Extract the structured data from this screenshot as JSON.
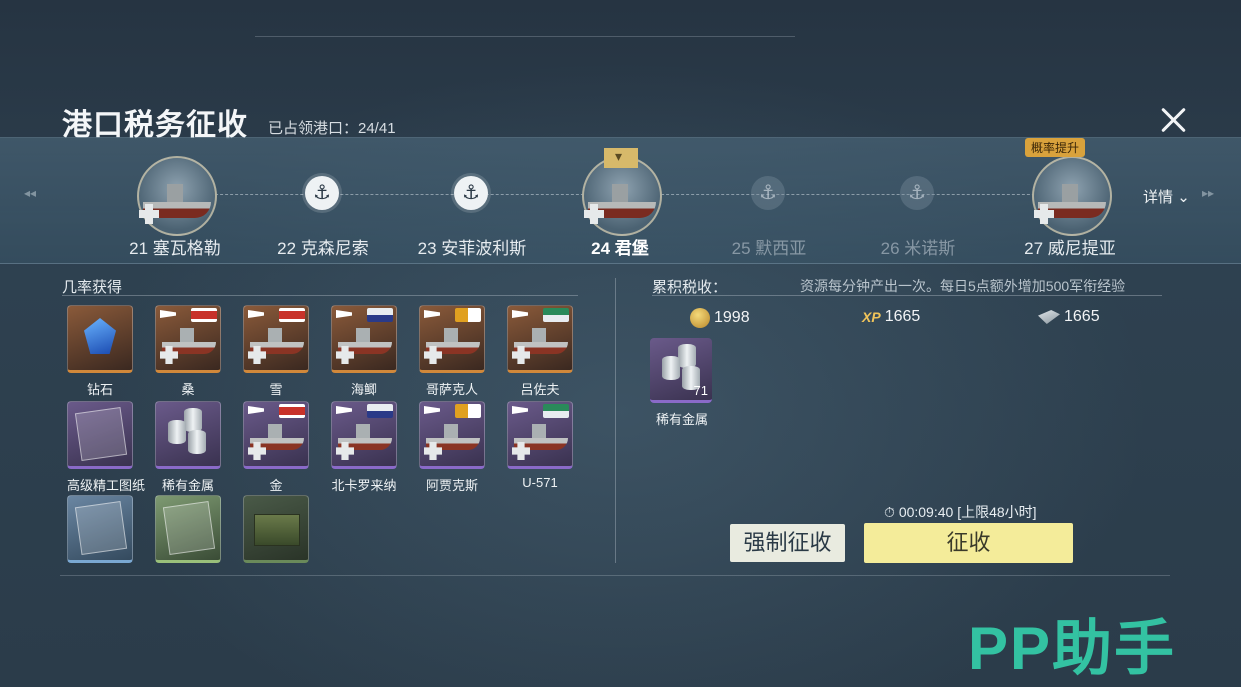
{
  "header": {
    "title": "港口税务征收",
    "occupied": "已占领港口：24/41"
  },
  "route": {
    "details_label": "详情",
    "probability_badge": "概率提升",
    "nodes": [
      {
        "label": "21 塞瓦格勒",
        "state": "ship"
      },
      {
        "label": "22 克森尼索",
        "state": "anchor"
      },
      {
        "label": "23 安菲波利斯",
        "state": "anchor"
      },
      {
        "label": "24 君堡",
        "state": "current"
      },
      {
        "label": "25 默西亚",
        "state": "locked"
      },
      {
        "label": "26 米诺斯",
        "state": "locked"
      },
      {
        "label": "27 威尼提亚",
        "state": "ship"
      }
    ]
  },
  "drops": {
    "title": "几率获得",
    "items": [
      {
        "name": "钻石",
        "rarity": "orange",
        "kind": "diamond"
      },
      {
        "name": "桑",
        "rarity": "orange",
        "kind": "ship",
        "flag": "red"
      },
      {
        "name": "雪",
        "rarity": "orange",
        "kind": "ship",
        "flag": "red"
      },
      {
        "name": "海鲫",
        "rarity": "orange",
        "kind": "ship",
        "flag": "us"
      },
      {
        "name": "哥萨克人",
        "rarity": "orange",
        "kind": "ship",
        "flag": "it"
      },
      {
        "name": "吕佐夫",
        "rarity": "orange",
        "kind": "ship",
        "flag": "de"
      },
      {
        "name": "高级精工图纸",
        "rarity": "purple",
        "kind": "blueprint"
      },
      {
        "name": "稀有金属",
        "rarity": "purple",
        "kind": "metal"
      },
      {
        "name": "金",
        "rarity": "purple",
        "kind": "ship",
        "flag": "red"
      },
      {
        "name": "北卡罗来纳",
        "rarity": "purple",
        "kind": "ship",
        "flag": "us"
      },
      {
        "name": "阿贾克斯",
        "rarity": "purple",
        "kind": "ship",
        "flag": "it"
      },
      {
        "name": "U-571",
        "rarity": "purple",
        "kind": "ship",
        "flag": "de"
      },
      {
        "name": "",
        "rarity": "blue",
        "kind": "blueprint"
      },
      {
        "name": "",
        "rarity": "green",
        "kind": "blueprint"
      },
      {
        "name": "",
        "rarity": "green",
        "kind": "crate"
      }
    ]
  },
  "accumulated": {
    "title": "累积税收：",
    "note": "资源每分钟产出一次。每日5点额外增加500军衔经验",
    "gold": "1998",
    "xp": "1665",
    "steel": "1665",
    "reward": {
      "name": "稀有金属",
      "count": "71"
    }
  },
  "actions": {
    "timer": "00:09:40 [上限48小时]",
    "force_label": "强制征收",
    "collect_label": "征收"
  },
  "watermark": "PP助手",
  "colors": {
    "collect_button": "#f4ec9a",
    "watermark": "#33c2a2"
  }
}
